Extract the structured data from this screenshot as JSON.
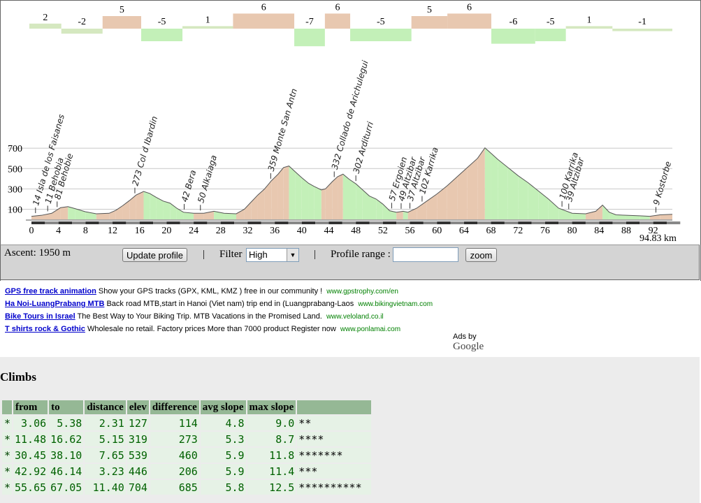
{
  "chart_data": {
    "type": "area",
    "xlabel": "",
    "ylabel": "",
    "x_unit_label": "94.83 km",
    "xlim": [
      0,
      94.83
    ],
    "ylim": [
      0,
      800
    ],
    "x_ticks": [
      0,
      4,
      8,
      12,
      16,
      20,
      24,
      28,
      32,
      36,
      40,
      44,
      48,
      52,
      56,
      60,
      64,
      68,
      72,
      76,
      80,
      84,
      88,
      92
    ],
    "y_ticks": [
      100,
      300,
      500,
      700
    ],
    "profile": [
      [
        0,
        30
      ],
      [
        1.5,
        40
      ],
      [
        3,
        60
      ],
      [
        4.3,
        115
      ],
      [
        5.4,
        125
      ],
      [
        6.5,
        105
      ],
      [
        8,
        75
      ],
      [
        9.6,
        55
      ],
      [
        11.5,
        60
      ],
      [
        12.5,
        90
      ],
      [
        13.5,
        135
      ],
      [
        14.5,
        185
      ],
      [
        15.5,
        240
      ],
      [
        16.6,
        275
      ],
      [
        17.5,
        255
      ],
      [
        18.5,
        215
      ],
      [
        19.5,
        180
      ],
      [
        20.5,
        160
      ],
      [
        21.5,
        110
      ],
      [
        22.5,
        70
      ],
      [
        24,
        60
      ],
      [
        25.5,
        60
      ],
      [
        27,
        80
      ],
      [
        28.5,
        60
      ],
      [
        30.3,
        55
      ],
      [
        31.5,
        100
      ],
      [
        32.5,
        170
      ],
      [
        33.5,
        240
      ],
      [
        34.5,
        300
      ],
      [
        35.5,
        380
      ],
      [
        36.5,
        445
      ],
      [
        37.3,
        510
      ],
      [
        38.1,
        525
      ],
      [
        39,
        470
      ],
      [
        40,
        410
      ],
      [
        41,
        355
      ],
      [
        41.8,
        325
      ],
      [
        42.9,
        290
      ],
      [
        43.5,
        300
      ],
      [
        44.5,
        370
      ],
      [
        45.3,
        420
      ],
      [
        46.1,
        445
      ],
      [
        47,
        395
      ],
      [
        48,
        350
      ],
      [
        49,
        290
      ],
      [
        50,
        230
      ],
      [
        51,
        200
      ],
      [
        52,
        150
      ],
      [
        53,
        85
      ],
      [
        54,
        70
      ],
      [
        55,
        80
      ],
      [
        55.7,
        70
      ],
      [
        57,
        110
      ],
      [
        58.5,
        180
      ],
      [
        60,
        250
      ],
      [
        61.5,
        330
      ],
      [
        63,
        420
      ],
      [
        64.5,
        510
      ],
      [
        66,
        600
      ],
      [
        67.1,
        704
      ],
      [
        68,
        650
      ],
      [
        69,
        590
      ],
      [
        70.5,
        510
      ],
      [
        72,
        430
      ],
      [
        73.5,
        360
      ],
      [
        75,
        280
      ],
      [
        76.5,
        200
      ],
      [
        78,
        110
      ],
      [
        80,
        60
      ],
      [
        82,
        55
      ],
      [
        83.5,
        80
      ],
      [
        84.5,
        140
      ],
      [
        85.5,
        70
      ],
      [
        86.5,
        45
      ],
      [
        88,
        40
      ],
      [
        90,
        35
      ],
      [
        91.5,
        30
      ],
      [
        93,
        45
      ],
      [
        94.83,
        50
      ]
    ],
    "segments": [
      {
        "from": 0,
        "to": 2.4,
        "value": "2",
        "dir": "up"
      },
      {
        "from": 2.4,
        "to": 5.5,
        "value": "-2",
        "dir": "down"
      },
      {
        "from": 5.5,
        "to": 8.4,
        "value": "5",
        "dir": "up"
      },
      {
        "from": 8.4,
        "to": 11.5,
        "value": "-5",
        "dir": "down"
      },
      {
        "from": 11.5,
        "to": 15.3,
        "value": "1",
        "dir": "up"
      },
      {
        "from": 15.3,
        "to": 19.9,
        "value": "6",
        "dir": "up"
      },
      {
        "from": 19.9,
        "to": 22.2,
        "value": "-7",
        "dir": "down"
      },
      {
        "from": 22.2,
        "to": 24.1,
        "value": "6",
        "dir": "up"
      },
      {
        "from": 24.1,
        "to": 28.7,
        "value": "-5",
        "dir": "down"
      },
      {
        "from": 28.7,
        "to": 31.4,
        "value": "5",
        "dir": "up"
      },
      {
        "from": 31.4,
        "to": 34.7,
        "value": "6",
        "dir": "up"
      },
      {
        "from": 34.7,
        "to": 38.0,
        "value": "-6",
        "dir": "down"
      },
      {
        "from": 38.0,
        "to": 40.3,
        "value": "-5",
        "dir": "down"
      },
      {
        "from": 40.3,
        "to": 43.8,
        "value": "1",
        "dir": "up"
      },
      {
        "from": 43.8,
        "to": 48.3,
        "value": "-1",
        "dir": "down"
      }
    ],
    "labels": [
      {
        "km": 0.6,
        "text": "14 Isla de los Faisanes"
      },
      {
        "km": 2.4,
        "text": "11 Behobia"
      },
      {
        "km": 3.8,
        "text": "81 Behobie"
      },
      {
        "km": 15.3,
        "text": "273 Col d Ibardin"
      },
      {
        "km": 22.6,
        "text": "42 Bera"
      },
      {
        "km": 25.0,
        "text": "50 Alkaiaga"
      },
      {
        "km": 35.4,
        "text": "359 Monte San Antn"
      },
      {
        "km": 44.8,
        "text": "332 Collado de Arichulegui"
      },
      {
        "km": 48.0,
        "text": "302 Arditurri"
      },
      {
        "km": 53.3,
        "text": "57 Ergoien"
      },
      {
        "km": 54.7,
        "text": "49 Altzibar"
      },
      {
        "km": 56.0,
        "text": "37 Altzibar"
      },
      {
        "km": 57.8,
        "text": "102 Karrika"
      },
      {
        "km": 78.5,
        "text": "100 Karrika"
      },
      {
        "km": 79.5,
        "text": "39 Altzibar"
      },
      {
        "km": 92.4,
        "text": "9 Kostorbe"
      }
    ]
  },
  "controls": {
    "ascent": "Ascent: 1950 m",
    "update_button": "Update profile",
    "separator": "|",
    "filter_label": "Filter",
    "filter_value": "High",
    "range_label": "Profile range :",
    "zoom_button": "zoom"
  },
  "ads": [
    {
      "title": "GPS free track animation",
      "text": "Show your GPS tracks (GPX, KML, KMZ ) free in our community !",
      "url": "www.gpstrophy.com/en"
    },
    {
      "title": "Ha Noi-LuangPrabang MTB",
      "text": "Back road MTB,start in Hanoi (Viet nam) trip end in (Luangprabang-Laos",
      "url": "www.bikingvietnam.com"
    },
    {
      "title": "Bike Tours in Israel",
      "text": "The Best Way to Your Biking Trip. MTB Vacations in the Promised Land.",
      "url": "www.veloland.co.il"
    },
    {
      "title": "T shirts rock & Gothic",
      "text": "Wholesale no retail. Factory prices More than 7000 product Register now",
      "url": "www.ponlamai.com"
    }
  ],
  "ads_by": "Ads by",
  "ads_brand": "Google",
  "climbs": {
    "title": "Climbs",
    "headers": [
      "",
      "from",
      "to",
      "distance",
      "elev",
      "difference",
      "avg slope",
      "max slope",
      ""
    ],
    "rows": [
      [
        "*",
        "3.06",
        "5.38",
        "2.31",
        "127",
        "114",
        "4.8",
        "9.0",
        "**"
      ],
      [
        "*",
        "11.48",
        "16.62",
        "5.15",
        "319",
        "273",
        "5.3",
        "8.7",
        "****"
      ],
      [
        "*",
        "30.45",
        "38.10",
        "7.65",
        "539",
        "460",
        "5.9",
        "11.8",
        "*******"
      ],
      [
        "*",
        "42.92",
        "46.14",
        "3.23",
        "446",
        "206",
        "5.9",
        "11.4",
        "***"
      ],
      [
        "*",
        "55.65",
        "67.05",
        "11.40",
        "704",
        "685",
        "5.8",
        "12.5",
        "**********"
      ]
    ]
  },
  "colors": {
    "up": "#e8c8b0",
    "down": "#c3f0b8",
    "flat": "#d5e8c0",
    "grid": "#c8c8c8"
  }
}
